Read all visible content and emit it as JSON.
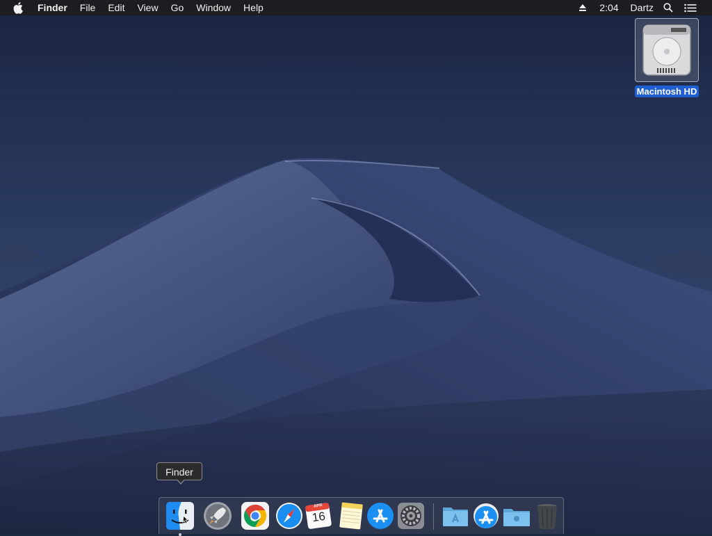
{
  "menubar": {
    "app_name": "Finder",
    "items": [
      "File",
      "Edit",
      "View",
      "Go",
      "Window",
      "Help"
    ],
    "time": "2:04",
    "user": "Dartz"
  },
  "desktop": {
    "drive_label": "Macintosh HD"
  },
  "tooltip": {
    "text": "Finder"
  },
  "dock": {
    "calendar_month": "APR",
    "calendar_day": "16",
    "items": [
      "finder",
      "launchpad",
      "chrome",
      "safari",
      "calendar",
      "notes",
      "app-store",
      "system-preferences",
      "applications-folder",
      "downloads-stack",
      "documents-folder",
      "trash"
    ]
  },
  "colors": {
    "menubar": "#1c1c1e",
    "selection": "#1f5fd1",
    "sky_top": "#1b2540",
    "dune": "#3a4a70"
  }
}
